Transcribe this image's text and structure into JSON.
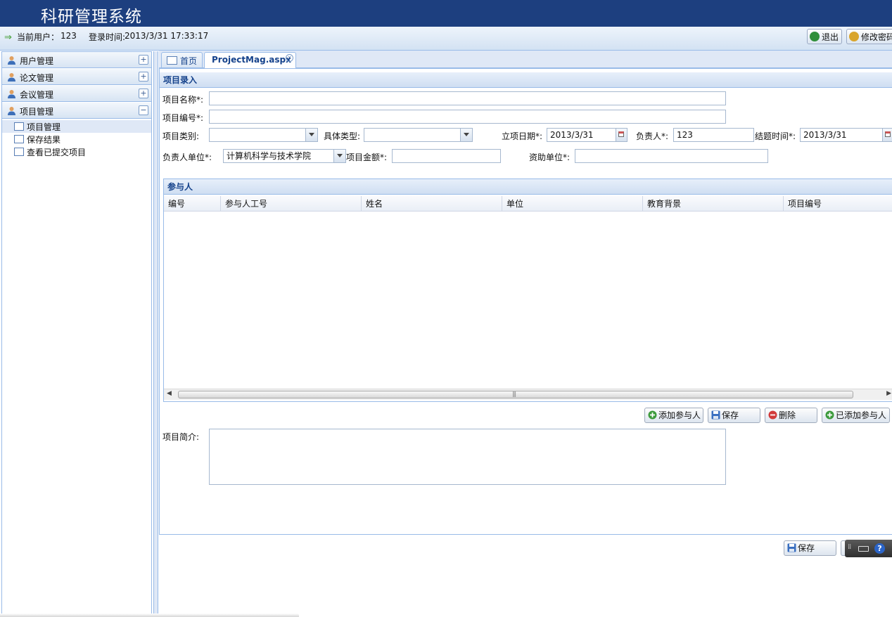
{
  "header": {
    "title": "科研管理系统"
  },
  "userbar": {
    "current_user_label": "当前用户：",
    "current_user": "123",
    "login_time_label": "登录时间:",
    "login_time": "2013/3/31 17:33:17",
    "logout_label": "退出",
    "change_password_label": "修改密码"
  },
  "sidebar": {
    "sections": [
      {
        "label": "用户管理",
        "toggle": "+"
      },
      {
        "label": "论文管理",
        "toggle": "+"
      },
      {
        "label": "会议管理",
        "toggle": "+"
      },
      {
        "label": "项目管理",
        "toggle": "−"
      }
    ],
    "project_items": [
      "项目管理",
      "保存结果",
      "查看已提交项目"
    ]
  },
  "tabs": [
    {
      "label": "首页"
    },
    {
      "label": "ProjectMag.aspx",
      "active": true
    }
  ],
  "form": {
    "panel_title": "项目录入",
    "project_name_label": "项目名称*:",
    "project_name_value": "",
    "project_number_label": "项目编号*:",
    "project_number_value": "",
    "category_label": "项目类别:",
    "category_value": "",
    "subtype_label": "具体类型:",
    "subtype_value": "",
    "start_date_label": "立项日期*:",
    "start_date_value": "2013/3/31",
    "leader_label": "负责人*:",
    "leader_value": "123",
    "end_date_label": "结题时间*:",
    "end_date_value": "2013/3/31",
    "leader_unit_label": "负责人单位*:",
    "leader_unit_value": "计算机科学与技术学院",
    "amount_label": "项目金额*:",
    "amount_value": "",
    "sponsor_label": "资助单位*:",
    "sponsor_value": "",
    "intro_label": "项目简介:",
    "intro_value": ""
  },
  "participants": {
    "title": "参与人",
    "columns": [
      "编号",
      "参与人工号",
      "姓名",
      "单位",
      "教育背景",
      "项目编号"
    ],
    "rows": []
  },
  "actions": {
    "add_participant": "添加参与人",
    "save": "保存",
    "delete": "删除",
    "added_participants": "已添加参与人",
    "bottom_save": "保存"
  },
  "colors": {
    "header_bg": "#1d3f7f",
    "panel_border": "#99bbe8",
    "title_text": "#15428b"
  }
}
